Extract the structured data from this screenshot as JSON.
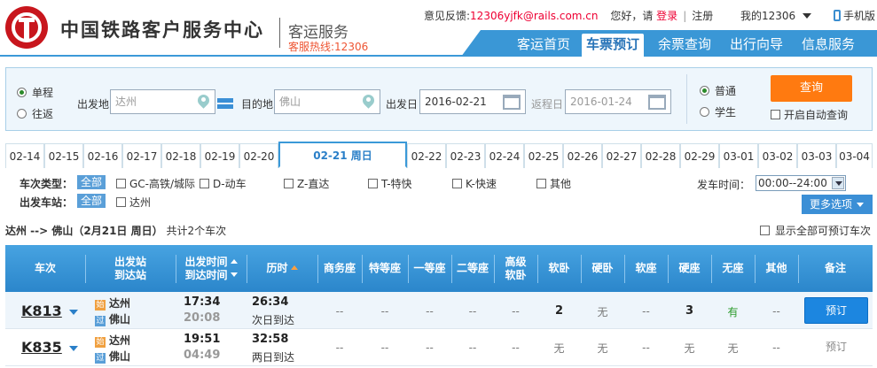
{
  "header": {
    "brand": "中国铁路客户服务中心",
    "service": "客运服务",
    "hotline": "客服热线:12306",
    "feedback_label": "意见反馈:",
    "feedback_email": "12306yjfk@rails.com.cn",
    "greeting": "您好，请",
    "login": "登录",
    "register": "注册",
    "my_account": "我的12306",
    "mobile": "手机版"
  },
  "nav": {
    "items": [
      {
        "label": "客运首页"
      },
      {
        "label": "车票预订"
      },
      {
        "label": "余票查询"
      },
      {
        "label": "出行向导"
      },
      {
        "label": "信息服务"
      }
    ]
  },
  "search": {
    "trip_single": "单程",
    "trip_round": "往返",
    "from_label": "出发地",
    "from_value": "达州",
    "to_label": "目的地",
    "to_value": "佛山",
    "depart_label": "出发日",
    "depart_value": "2016-02-21",
    "return_label": "返程日",
    "return_value": "2016-01-24",
    "type_normal": "普通",
    "type_student": "学生",
    "query_button": "查询",
    "auto_query": "开启自动查询"
  },
  "dates": [
    "02-14",
    "02-15",
    "02-16",
    "02-17",
    "02-18",
    "02-19",
    "02-20",
    "02-21 周日",
    "02-22",
    "02-23",
    "02-24",
    "02-25",
    "02-26",
    "02-27",
    "02-28",
    "02-29",
    "03-01",
    "03-02",
    "03-03",
    "03-04"
  ],
  "filters": {
    "type_label": "车次类型：",
    "all": "全部",
    "types": [
      "GC-高铁/城际",
      "D-动车",
      "Z-直达",
      "T-特快",
      "K-快速",
      "其他"
    ],
    "station_label": "出发车站：",
    "station": "达州",
    "time_label": "发车时间：",
    "time_value": "00:00--24:00",
    "more": "更多选项"
  },
  "summary": {
    "route": "达州 --> 佛山（2月21日 周日）",
    "count": "共计2个车次",
    "show_all": "显示全部可预订车次"
  },
  "table": {
    "headers": {
      "train": "车次",
      "station_a": "出发站",
      "station_b": "到达站",
      "time_a": "出发时间",
      "time_b": "到达时间",
      "duration": "历时",
      "business": "商务座",
      "special": "特等座",
      "first": "一等座",
      "second": "二等座",
      "hsoft_a": "高级",
      "hsoft_b": "软卧",
      "soft_sleeper": "软卧",
      "hard_sleeper": "硬卧",
      "soft_seat": "软座",
      "hard_seat": "硬座",
      "no_seat": "无座",
      "other": "其他",
      "remark": "备注"
    },
    "start_tag": "始",
    "pass_tag": "过",
    "rows": [
      {
        "train": "K813",
        "from": "达州",
        "to": "佛山",
        "depart": "17:34",
        "arrive": "20:08",
        "duration": "26:34",
        "arrive_note": "次日到达",
        "business": "--",
        "special": "--",
        "first": "--",
        "second": "--",
        "hsoft": "--",
        "soft_sleeper": "2",
        "hard_sleeper": "无",
        "soft_seat": "--",
        "hard_seat": "3",
        "no_seat": "有",
        "other": "--",
        "remark": "预订"
      },
      {
        "train": "K835",
        "from": "达州",
        "to": "佛山",
        "depart": "19:51",
        "arrive": "04:49",
        "duration": "32:58",
        "arrive_note": "两日到达",
        "business": "--",
        "special": "--",
        "first": "--",
        "second": "--",
        "hsoft": "--",
        "soft_sleeper": "无",
        "hard_sleeper": "无",
        "soft_seat": "--",
        "hard_seat": "无",
        "no_seat": "无",
        "other": "--",
        "remark": "预订"
      }
    ]
  }
}
